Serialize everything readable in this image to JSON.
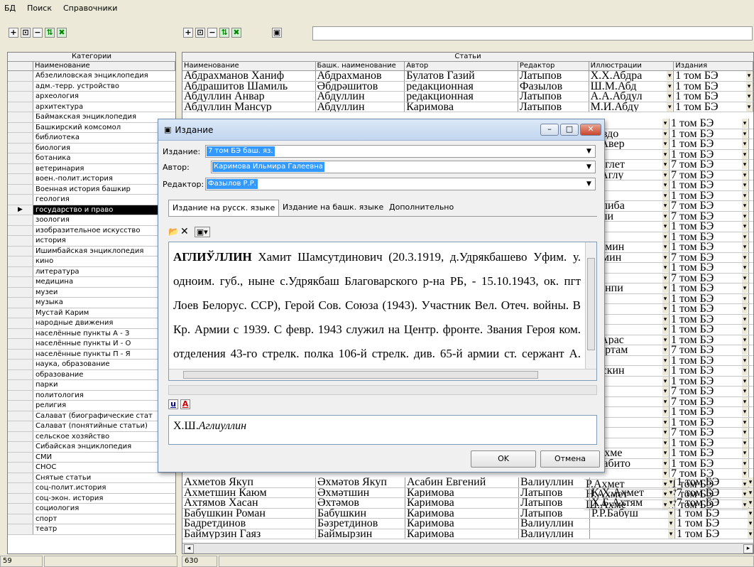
{
  "menu": [
    "БД",
    "Поиск",
    "Справочники"
  ],
  "left_toolbar": [
    "+",
    "⊡",
    "−",
    "⇅",
    "✖"
  ],
  "right_toolbar": [
    "+",
    "⊡",
    "−",
    "⇅",
    "✖",
    "▣"
  ],
  "categories": {
    "title": "Категории",
    "column": "Наименование",
    "selected_index": 13,
    "items": [
      "Абзелиловская энциклопедия",
      "адм.-терр. устройство",
      "археология",
      "архитектура",
      "Баймакская энциклопедия",
      "Башкирский комсомол",
      "библиотека",
      "биология",
      "ботаника",
      "ветеринария",
      "воен.-полит.история",
      "Военная история башкир",
      "геология",
      "государство и право",
      "зоология",
      "изобразительное искусство",
      "история",
      "Ишимбайская энциклопедия",
      "кино",
      "литература",
      "медицина",
      "музеи",
      "музыка",
      "Мустай Карим",
      "народные движения",
      "населённые пункты А - З",
      "населённые пункты И - О",
      "населённые пункты П - Я",
      "наука, образование",
      "образование",
      "парки",
      "политология",
      "религия",
      "Салават (биографические стат",
      "Салават (понятийные статьи)",
      "сельское хозяйство",
      "Сибайская энциклопедия",
      "СМИ",
      "СНОС",
      "Снятые статьи",
      "соц-полит.история",
      "соц-экон. история",
      "социология",
      "спорт",
      "театр"
    ],
    "status": "59"
  },
  "articles": {
    "title": "Статьи",
    "columns": [
      "Наименование",
      "Башк. наименование",
      "Автор",
      "Редактор",
      "Иллюстрации",
      "Издания"
    ],
    "top_rows": [
      [
        "Абдрахманов Ханиф",
        "Абдрахманов",
        "Булатов Газий",
        "Латыпов",
        "Х.Х.Абдра",
        "1 том БЭ"
      ],
      [
        "Абдрашитов Шамиль",
        "Әбдрәшитов",
        "редакционная",
        "Фазылов",
        "Ш.М.Абд",
        "1 том БЭ"
      ],
      [
        "Абдуллин Анвар",
        "Абдуллин",
        "редакционная",
        "Латыпов",
        "А.А.Абдул",
        "1 том БЭ"
      ],
      [
        "Абдуллин Мансур",
        "Абдуллин",
        "Каримова",
        "Латыпов",
        "М.И.Абду",
        "1 том БЭ"
      ]
    ],
    "side_ill": [
      "",
      "Г.Авдо",
      "Ю.Авер",
      "",
      "Х.Аглет",
      "Ш.Аглу",
      "",
      "",
      "Г.Алиба",
      "Р.Али",
      "",
      "",
      "Х.Амин",
      "Г.Амин",
      "",
      "",
      "И.Анпи",
      "",
      "",
      "",
      "",
      "Ш.Арас",
      "И.Артам",
      "",
      "Г.Аскин",
      "",
      "",
      "",
      "",
      "",
      "",
      "",
      "В.Ахме",
      "А.Габито",
      "",
      "Р.Ахмет",
      "Н.Ахмет",
      "Ш.Ахме"
    ],
    "side_ed": [
      "1 том БЭ",
      "1 том БЭ",
      "1 том БЭ",
      "1 том БЭ",
      "7 том БЭ",
      "7 том БЭ",
      "1 том БЭ",
      "1 том БЭ",
      "7 том БЭ",
      "7 том БЭ",
      "1 том БЭ",
      "1 том БЭ",
      "1 том БЭ",
      "7 том БЭ",
      "1 том БЭ",
      "7 том БЭ",
      "1 том БЭ",
      "1 том БЭ",
      "1 том БЭ",
      "1 том БЭ",
      "1 том БЭ",
      "1 том БЭ",
      "7 том БЭ",
      "1 том БЭ",
      "1 том БЭ",
      "1 том БЭ",
      "7 том БЭ",
      "7 том БЭ",
      "1 том БЭ",
      "1 том БЭ",
      "7 том БЭ",
      "1 том БЭ",
      "1 том БЭ",
      "1 том БЭ",
      "7 том БЭ",
      "1 том БЭ",
      "7 том БЭ",
      "7 том БЭ"
    ],
    "bottom_rows": [
      [
        "Ахметов Якуп",
        "Әхмәтов Якуп",
        "Асабин Евгений",
        "Валиуллин",
        "",
        "1 том БЭ"
      ],
      [
        "Ахметшин Каюм",
        "Әхмәтшин",
        "Каримова",
        "Латыпов",
        "К.Х.Ахмет",
        "7 том БЭ"
      ],
      [
        "Ахтямов Хасан",
        "Әхтәмов",
        "Каримова",
        "Латыпов",
        "Х.Б.Ахтям",
        "7 том БЭ"
      ],
      [
        "Бабушкин Роман",
        "Бабушкин",
        "Каримова",
        "Латыпов",
        "Р.Р.Бабуш",
        "1 том БЭ"
      ],
      [
        "Бадретдинов",
        "Бәзретдинов",
        "Каримова",
        "Валиуллин",
        "",
        "1 том БЭ"
      ],
      [
        "Баймурзин Гаяз",
        "Баймырзин",
        "Каримова",
        "Валиуллин",
        "",
        "1 том БЭ"
      ]
    ],
    "status": "630"
  },
  "dialog": {
    "title": "Издание",
    "izdanie_label": "Издание:",
    "izdanie_value": "7 том БЭ баш. яз.",
    "author_label": "Автор:",
    "author_value": "Каримова Ильмира Галеевна",
    "editor_label": "Редактор:",
    "editor_value": "Фазылов Р.Р.",
    "tabs": [
      "Издание на русск. языке",
      "Издание на башк. языке",
      "Дополнительно"
    ],
    "heading": "АГЛИЎЛЛИН",
    "body": "Хамит Шамсутдинович (20.3.1919, д.Удрякбашево Уфим. у. одноим. губ., ныне с.Удрякбаш Благоварского р-на РБ, - 15.10.1943, ок. пгт Лоев Белорус. ССР), Герой Сов. Союза (1943). Участник Вел. Отеч. войны. В Кр. Армии с 1939. С февр. 1943 служил на Центр. фронте. Звания Героя ком. отделения 43-го стрелк. полка 106-й стрелк. див. 65-й армии ст. сержант А. удостоен посм. за",
    "signature_prefix": "Х.Ш.",
    "signature_name": "Аглиуллин",
    "ok": "OK",
    "cancel": "Отмена"
  }
}
